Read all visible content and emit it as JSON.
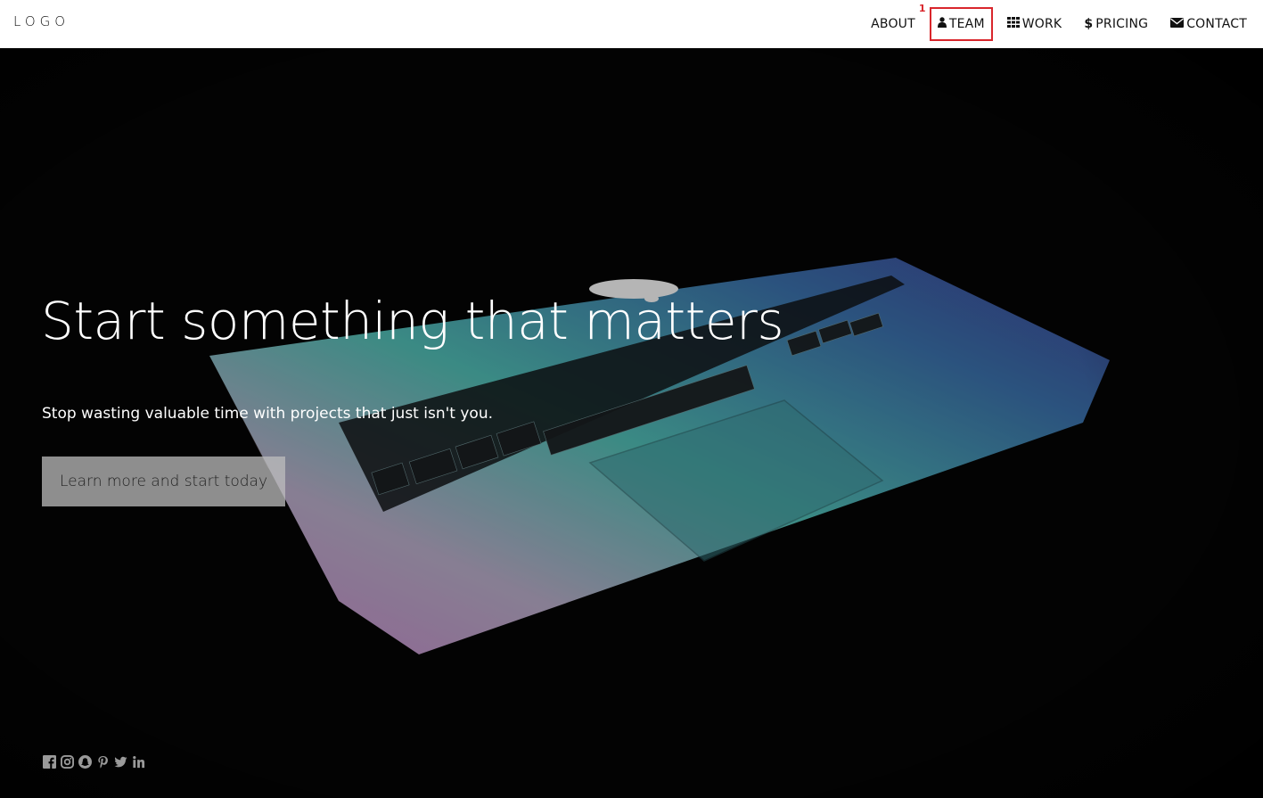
{
  "header": {
    "logo": "LOGO",
    "nav": [
      {
        "label": "ABOUT",
        "icon": ""
      },
      {
        "label": "TEAM",
        "icon": "user-icon"
      },
      {
        "label": "WORK",
        "icon": "grid-icon"
      },
      {
        "label": "PRICING",
        "icon": "dollar-icon"
      },
      {
        "label": "CONTACT",
        "icon": "envelope-icon"
      }
    ],
    "marker": "1"
  },
  "hero": {
    "title": "Start something that matters",
    "subtitle": "Stop wasting valuable time with projects that just isn't you.",
    "cta_label": "Learn more and start today"
  },
  "social": [
    "facebook-icon",
    "instagram-icon",
    "snapchat-icon",
    "pinterest-icon",
    "twitter-icon",
    "linkedin-icon"
  ],
  "colors": {
    "header_bg": "#ffffff",
    "hero_bg": "#050505",
    "marker": "#d9262c",
    "cta_bg": "#bebebe"
  }
}
